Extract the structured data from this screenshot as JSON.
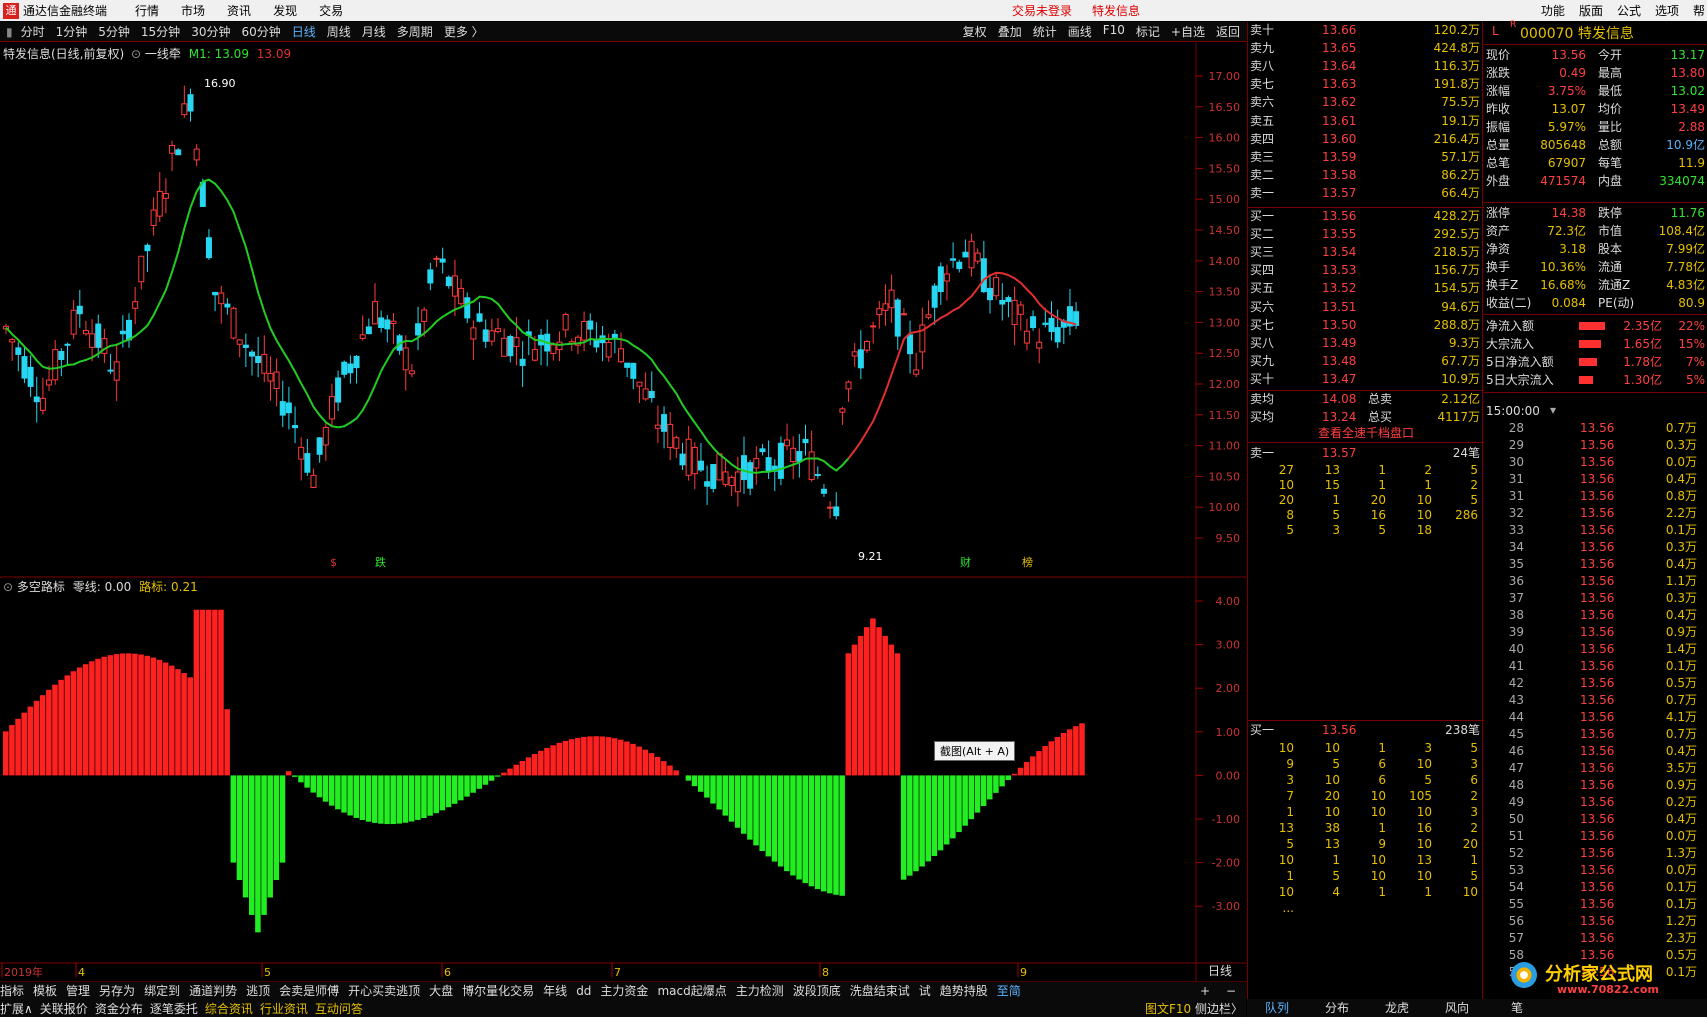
{
  "app": {
    "title": "通达信金融终端",
    "menus": [
      "行情",
      "市场",
      "资讯",
      "发现",
      "交易"
    ],
    "status_login": "交易未登录",
    "status_stock": "特发信息",
    "right_menus": [
      "功能",
      "版面",
      "公式",
      "选项",
      "帮"
    ]
  },
  "toolbar": {
    "periods": [
      "分时",
      "1分钟",
      "5分钟",
      "15分钟",
      "30分钟",
      "60分钟",
      "日线",
      "周线",
      "月线",
      "多周期",
      "更多 〉"
    ],
    "active": "日线",
    "tools": [
      "复权",
      "叠加",
      "统计",
      "画线",
      "F10",
      "标记",
      "+自选",
      "返回"
    ]
  },
  "main_chart": {
    "title": "特发信息(日线,前复权)",
    "indicator": "一线牵",
    "m1_label": "M1: 13.09",
    "m1_value": "13.09",
    "high_label": "16.90",
    "low_label": "9.21",
    "y_ticks": [
      "17.00",
      "16.50",
      "16.00",
      "15.50",
      "15.00",
      "14.50",
      "14.00",
      "13.50",
      "13.00",
      "12.50",
      "12.00",
      "11.50",
      "11.00",
      "10.50",
      "10.00",
      "9.50"
    ],
    "events": [
      "$",
      "跌",
      "财",
      "榜"
    ],
    "ma_color": "#22cc22",
    "ma_up_color": "#e03030"
  },
  "sub_chart": {
    "title": "多空路标",
    "zero_label": "零线: 0.00",
    "signal_label": "路标: 0.21",
    "y_ticks": [
      "4.00",
      "3.00",
      "2.00",
      "1.00",
      "0.00",
      "-1.00",
      "-2.00",
      "-3.00"
    ],
    "tooltip": "截图(Alt + A)"
  },
  "x_axis": {
    "labels": [
      "2019年",
      "4",
      "5",
      "6",
      "7",
      "8",
      "9"
    ],
    "period_label": "日线"
  },
  "formulas": [
    "指标",
    "模板",
    "管理",
    "另存为",
    "绑定到",
    "通道判势",
    "逃顶",
    "会卖是师傅",
    "开心买卖逃顶",
    "大盘",
    "博尔量化交易",
    "年线",
    "dd",
    "主力资金",
    "macd起爆点",
    "主力检测",
    "波段顶底",
    "洗盘结束试",
    "试",
    "趋势持股",
    "至简"
  ],
  "bottom_tabs": [
    "扩展∧",
    "关联报价",
    "资金分布",
    "逐笔委托",
    "综合资讯",
    "行业资讯",
    "互动问答"
  ],
  "sidebar_toggle": "图文F10",
  "sidebar_label": "侧边栏〉",
  "order_book": {
    "asks": [
      [
        "卖十",
        "13.66",
        "120.2万"
      ],
      [
        "卖九",
        "13.65",
        "424.8万"
      ],
      [
        "卖八",
        "13.64",
        "116.3万"
      ],
      [
        "卖七",
        "13.63",
        "191.8万"
      ],
      [
        "卖六",
        "13.62",
        "75.5万"
      ],
      [
        "卖五",
        "13.61",
        "19.1万"
      ],
      [
        "卖四",
        "13.60",
        "216.4万"
      ],
      [
        "卖三",
        "13.59",
        "57.1万"
      ],
      [
        "卖二",
        "13.58",
        "86.2万"
      ],
      [
        "卖一",
        "13.57",
        "66.4万"
      ]
    ],
    "bids": [
      [
        "买一",
        "13.56",
        "428.2万"
      ],
      [
        "买二",
        "13.55",
        "292.5万"
      ],
      [
        "买三",
        "13.54",
        "218.5万"
      ],
      [
        "买四",
        "13.53",
        "156.7万"
      ],
      [
        "买五",
        "13.52",
        "154.5万"
      ],
      [
        "买六",
        "13.51",
        "94.6万"
      ],
      [
        "买七",
        "13.50",
        "288.8万"
      ],
      [
        "买八",
        "13.49",
        "9.3万"
      ],
      [
        "买九",
        "13.48",
        "67.7万"
      ],
      [
        "买十",
        "13.47",
        "10.9万"
      ]
    ],
    "avg": [
      [
        "卖均",
        "14.08",
        "总卖",
        "2.12亿"
      ],
      [
        "买均",
        "13.24",
        "总买",
        "4117万"
      ]
    ],
    "link": "查看全速千档盘口",
    "ask_queue": {
      "label": "卖一",
      "price": "13.57",
      "count": "24笔",
      "rows": [
        [
          "27",
          "13",
          "1",
          "2",
          "5"
        ],
        [
          "10",
          "15",
          "1",
          "1",
          "2"
        ],
        [
          "20",
          "1",
          "20",
          "10",
          "5"
        ],
        [
          "8",
          "5",
          "16",
          "10",
          "286"
        ],
        [
          "5",
          "3",
          "5",
          "18",
          ""
        ]
      ]
    },
    "bid_queue": {
      "label": "买一",
      "price": "13.56",
      "count": "238笔",
      "rows": [
        [
          "10",
          "10",
          "1",
          "3",
          "5"
        ],
        [
          "9",
          "5",
          "6",
          "10",
          "3"
        ],
        [
          "3",
          "10",
          "6",
          "5",
          "6"
        ],
        [
          "7",
          "20",
          "10",
          "105",
          "2"
        ],
        [
          "1",
          "10",
          "10",
          "10",
          "3"
        ],
        [
          "13",
          "38",
          "1",
          "16",
          "2"
        ],
        [
          "5",
          "13",
          "9",
          "10",
          "20"
        ],
        [
          "10",
          "1",
          "10",
          "13",
          "1"
        ],
        [
          "1",
          "5",
          "10",
          "10",
          "5"
        ],
        [
          "10",
          "4",
          "1",
          "1",
          "10"
        ],
        [
          "...",
          "",
          "",
          "",
          ""
        ]
      ]
    }
  },
  "quote": {
    "header": "000070 特发信息",
    "l_label": "L",
    "r_label": "R",
    "stats": [
      [
        "现价",
        "13.56",
        "今开",
        "13.17"
      ],
      [
        "涨跌",
        "0.49",
        "最高",
        "13.80"
      ],
      [
        "涨幅",
        "3.75%",
        "最低",
        "13.02"
      ],
      [
        "昨收",
        "13.07",
        "均价",
        "13.49"
      ],
      [
        "振幅",
        "5.97%",
        "量比",
        "2.88"
      ],
      [
        "总量",
        "805648",
        "总额",
        "10.9亿"
      ],
      [
        "总笔",
        "67907",
        "每笔",
        "11.9"
      ],
      [
        "外盘",
        "471574",
        "内盘",
        "334074"
      ]
    ],
    "stats2": [
      [
        "涨停",
        "14.38",
        "跌停",
        "11.76"
      ],
      [
        "资产",
        "72.3亿",
        "市值",
        "108.4亿"
      ],
      [
        "净资",
        "3.18",
        "股本",
        "7.99亿"
      ],
      [
        "换手",
        "10.36%",
        "流通",
        "7.78亿"
      ],
      [
        "换手Z",
        "16.68%",
        "流通Z",
        "4.83亿"
      ],
      [
        "收益(二)",
        "0.084",
        "PE(动)",
        "80.9"
      ]
    ],
    "flows": [
      [
        "净流入额",
        "2.35亿",
        "22%"
      ],
      [
        "大宗流入",
        "1.65亿",
        "15%"
      ],
      [
        "5日净流入额",
        "1.78亿",
        "7%"
      ],
      [
        "5日大宗流入",
        "1.30亿",
        "5%"
      ]
    ],
    "ticks_time": "15:00:00",
    "ticks": [
      [
        "28",
        "13.56",
        "0.7万"
      ],
      [
        "29",
        "13.56",
        "0.3万"
      ],
      [
        "30",
        "13.56",
        "0.0万"
      ],
      [
        "31",
        "13.56",
        "0.4万"
      ],
      [
        "31",
        "13.56",
        "0.8万"
      ],
      [
        "32",
        "13.56",
        "2.2万"
      ],
      [
        "33",
        "13.56",
        "0.1万"
      ],
      [
        "34",
        "13.56",
        "0.3万"
      ],
      [
        "35",
        "13.56",
        "0.4万"
      ],
      [
        "36",
        "13.56",
        "1.1万"
      ],
      [
        "37",
        "13.56",
        "0.3万"
      ],
      [
        "38",
        "13.56",
        "0.4万"
      ],
      [
        "39",
        "13.56",
        "0.9万"
      ],
      [
        "40",
        "13.56",
        "1.4万"
      ],
      [
        "41",
        "13.56",
        "0.1万"
      ],
      [
        "42",
        "13.56",
        "0.5万"
      ],
      [
        "43",
        "13.56",
        "0.7万"
      ],
      [
        "44",
        "13.56",
        "4.1万"
      ],
      [
        "45",
        "13.56",
        "0.7万"
      ],
      [
        "46",
        "13.56",
        "0.4万"
      ],
      [
        "47",
        "13.56",
        "3.5万"
      ],
      [
        "48",
        "13.56",
        "0.9万"
      ],
      [
        "49",
        "13.56",
        "0.2万"
      ],
      [
        "50",
        "13.56",
        "0.4万"
      ],
      [
        "51",
        "13.56",
        "0.0万"
      ],
      [
        "52",
        "13.56",
        "1.3万"
      ],
      [
        "53",
        "13.56",
        "0.0万"
      ],
      [
        "54",
        "13.56",
        "0.1万"
      ],
      [
        "55",
        "13.56",
        "0.1万"
      ],
      [
        "56",
        "13.56",
        "1.2万"
      ],
      [
        "57",
        "13.56",
        "2.3万"
      ],
      [
        "58",
        "13.56",
        "0.5万"
      ],
      [
        "59",
        "13.56",
        "0.1万"
      ]
    ],
    "tabs": [
      "队列",
      "分布",
      "龙虎",
      "风向",
      "笔"
    ]
  },
  "watermark": {
    "line1": "分析家公式网",
    "line2": "www.70822.com"
  }
}
